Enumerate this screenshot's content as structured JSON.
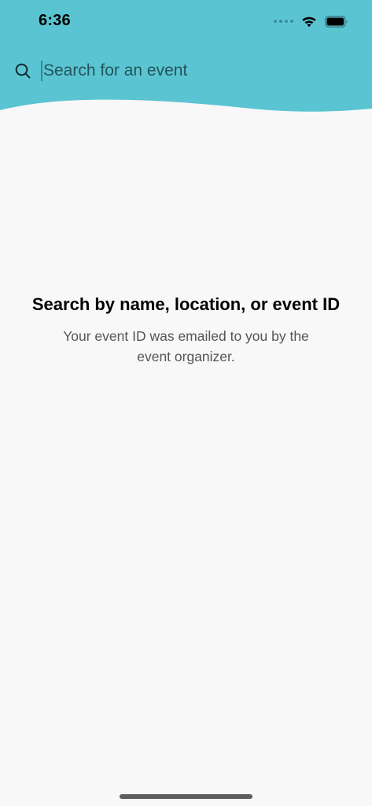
{
  "status_bar": {
    "time": "6:36"
  },
  "search": {
    "placeholder": "Search for an event",
    "value": ""
  },
  "empty_state": {
    "title": "Search by name, location, or event ID",
    "subtitle": "Your event ID was emailed to you by the event organizer."
  },
  "icons": {
    "search": "search-icon",
    "wifi": "wifi-icon",
    "battery": "battery-icon",
    "signal": "signal-dots-icon"
  },
  "colors": {
    "header": "#5bc4d2",
    "background": "#f8f8f8",
    "accent": "#2f8a96"
  }
}
